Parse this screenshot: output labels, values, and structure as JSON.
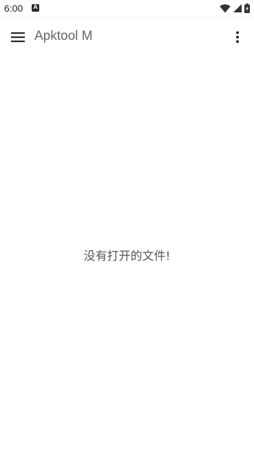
{
  "status_bar": {
    "time": "6:00",
    "icons": [
      "app-notification-icon",
      "wifi-icon",
      "cell-signal-icon",
      "battery-charging-icon"
    ]
  },
  "app_bar": {
    "title": "Apktool M",
    "menu_icon": "hamburger-menu-icon",
    "overflow_icon": "more-vertical-icon"
  },
  "main": {
    "empty_message": "没有打开的文件!"
  }
}
